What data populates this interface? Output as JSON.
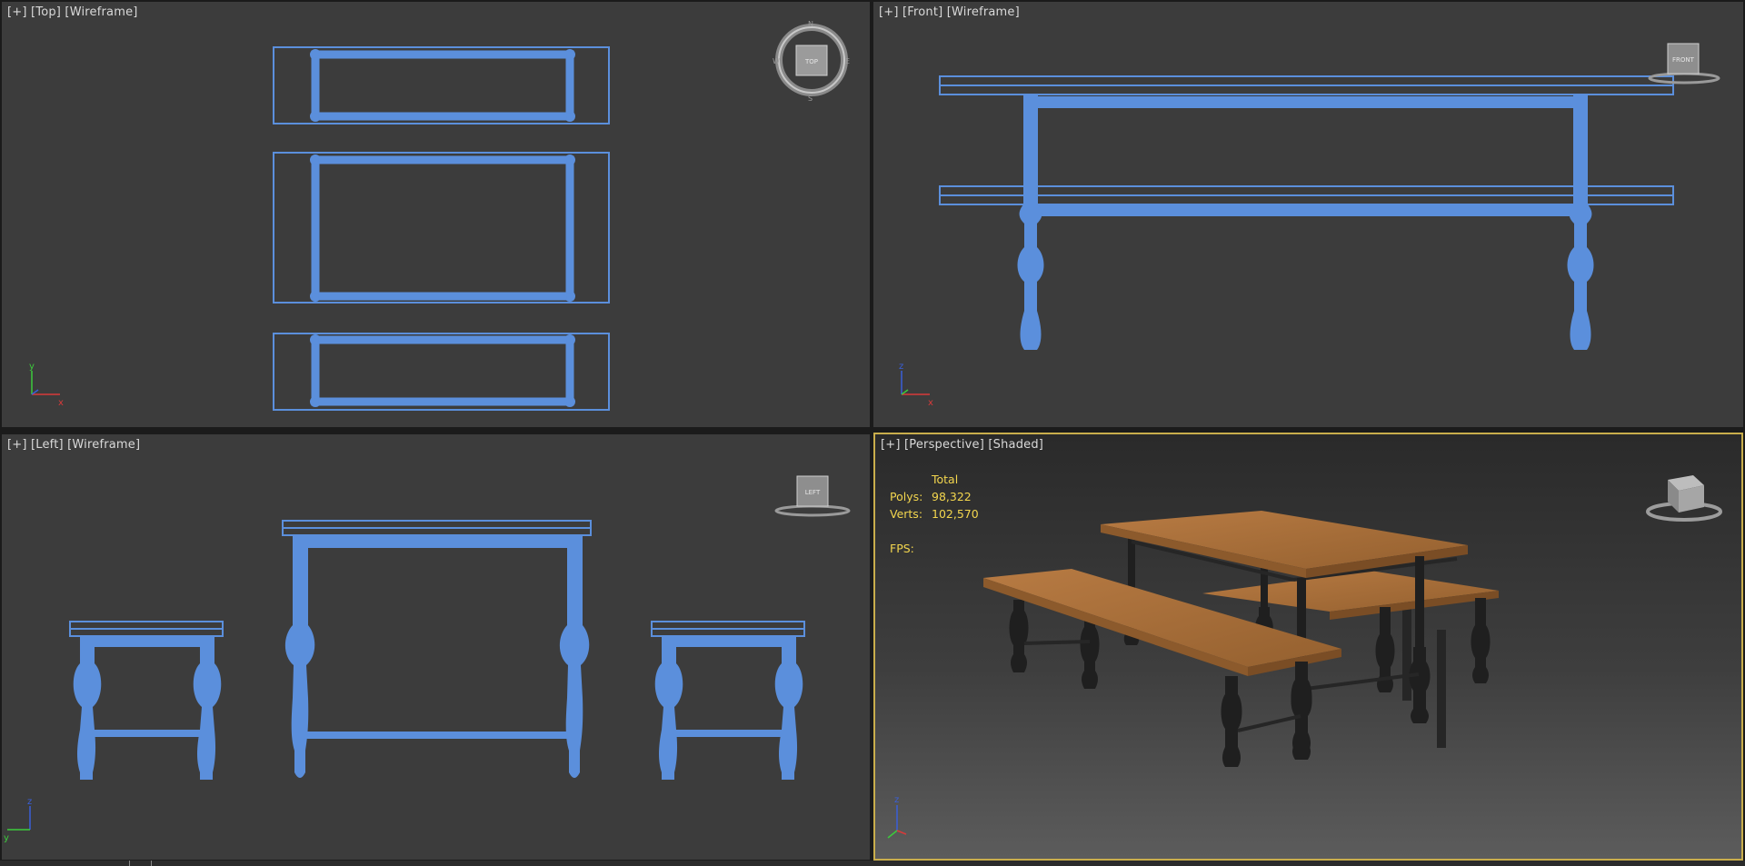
{
  "viewports": {
    "top": {
      "menu": "[+]",
      "view": "[Top]",
      "shading": "[Wireframe]",
      "viewcube_face": "TOP",
      "compass": {
        "north": "N",
        "south": "S",
        "west": "W",
        "east": "E"
      },
      "axis": {
        "up": "y",
        "right": "x"
      }
    },
    "front": {
      "menu": "[+]",
      "view": "[Front]",
      "shading": "[Wireframe]",
      "viewcube_face": "FRONT",
      "axis": {
        "up": "z",
        "right": "x"
      }
    },
    "left": {
      "menu": "[+]",
      "view": "[Left]",
      "shading": "[Wireframe]",
      "viewcube_face": "LEFT",
      "axis": {
        "up": "z",
        "left": "y"
      }
    },
    "perspective": {
      "menu": "[+]",
      "view": "[Perspective]",
      "shading": "[Shaded]",
      "axis": {
        "up": "z"
      },
      "stats": {
        "header": "Total",
        "polys_label": "Polys:",
        "polys": "98,322",
        "verts_label": "Verts:",
        "verts": "102,570",
        "fps_label": "FPS:"
      }
    }
  },
  "colors": {
    "wireframe": "#5b8fdc",
    "viewport_bg": "#3c3c3c",
    "active_border": "#c9ae4c",
    "stats_text": "#f3d64e",
    "wood": "#a56a36",
    "metal": "#2a2a2a"
  }
}
